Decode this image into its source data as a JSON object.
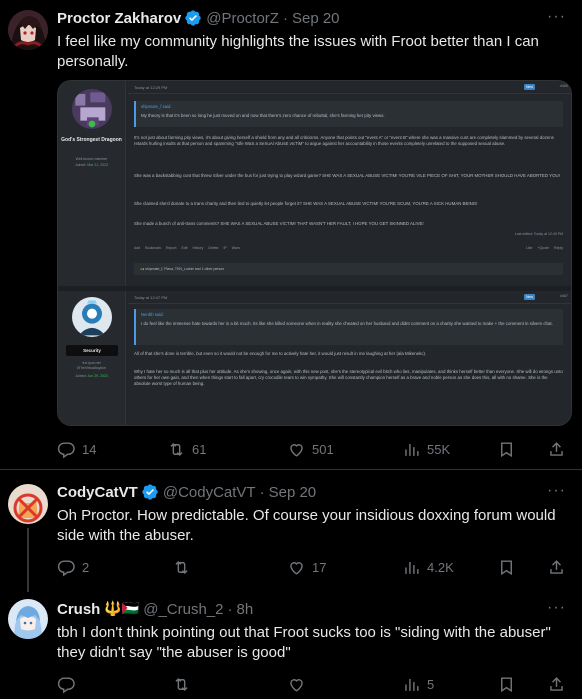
{
  "tweets": [
    {
      "name": "Proctor Zakharov",
      "handle": "@ProctorZ",
      "time": "Sep 20",
      "text": "I feel like my community highlights the issues with Froot better than I can personally.",
      "stats": {
        "replies": "14",
        "reposts": "61",
        "likes": "501",
        "views": "55K"
      },
      "avatar_icon": "anime-avatar-icon"
    },
    {
      "name": "CodyCatVT",
      "handle": "@CodyCatVT",
      "time": "Sep 20",
      "text": "Oh Proctor. How predictable. Of course your insidious doxxing forum would side with the abuser.",
      "stats": {
        "replies": "2",
        "reposts": "",
        "likes": "17",
        "views": "4.2K"
      },
      "avatar_icon": "cat-no-symbol-icon"
    },
    {
      "name": "Crush",
      "handle": "@_Crush_2",
      "time": "8h",
      "name_emojis": "🔱🇵🇸",
      "text": "tbh I don't think pointing out that Froot sucks too is \"siding with the abuser\" they didn't say \"the abuser is good\"",
      "stats": {
        "replies": "",
        "reposts": "",
        "likes": "",
        "views": "5"
      },
      "avatar_icon": "anime-avatar-blue-icon"
    }
  ],
  "forum": {
    "post1": {
      "timestamp": "Today at 12:29 PM",
      "badge": "New",
      "number": "#465",
      "user_title": "God's Strongest Dragoon",
      "user_role": "Well-known member",
      "joined_label": "Joined:",
      "joined": "Mar 21, 2023",
      "quote_author": "shipmate_f said:",
      "quote_text": "My theory is that it's been so long he just moved on and now that there's zero chance of rebuttal, she's farming her pity views.",
      "paragraphs": [
        "It's not just about farming pity views, it's about giving herself a shield from any and all criticisms. Anyone that points out \"event A\" or \"event B\" where she was a massive cunt are completely slammed by several dozens retards hurling insults at that person and spamming \"stfe WaS a SeXuAl AbUsE vIcTiM\" to argue against her accountability in those events completely unrelated to the supposed sexual abuse.",
        "She was a backstabbing cunt that threw Silver under the bus for just trying to play wizard game? SHE WAS A SEXUAL ABUSE VICTIM! YOU'RE VILE PIECE OF SHIT, YOUR MOTHER SHOULD HAVE ABORTED YOU!",
        "She claimed she'd donate to a trans charity and then lied to quietly let people forget it? SHE WAS A SEXUAL ABUSE VICTIM! YOU'RE SCUM, YOU'RE A SICK HUMAN BEING!",
        "She made a bunch of anti-trans comments? SHE WAS A SEXUAL ABUSE VICTIM! THAT WASN'T HER FAULT, I HOPE YOU GET SKINNED ALIVE!"
      ],
      "edited": "Last edited: Today at 12:49 PM",
      "links": [
        "Add Bookmark",
        "Report",
        "Edit",
        "History",
        "Delete",
        "IP",
        "Warn"
      ],
      "actions": [
        "Like",
        "+Quote",
        "Reply"
      ],
      "reactions": "shipmate_f, Plava, TKN_Lurker and 1 other person"
    },
    "post2": {
      "timestamp": "Today at 12:47 PM",
      "badge": "New",
      "number": "#467",
      "user_badge": "Security",
      "user_role": "trci.ipun.net",
      "user_tag": "#TheVirtualAsylum",
      "joined_label": "Joined:",
      "joined": "Jun 29, 2023",
      "quote_author": "Nerdth said:",
      "quote_text": "I do feel like the immense hate towards her is a bit much. Its like she killed someone when in reality she cheated on her husband and didnt comment on a charity she wanted to make + the comment in silvers chat.",
      "paragraphs": [
        "All of that she's done is terrible, but even so it would not be enough for me to actively hate her, it would just result in me laughing at her (ala Mikenekc).",
        "Why I hate her so much is all that plus her attitude. As she's showing, once again, with this new post, she's the stereotypical evil bitch who lies, manipulates, and thinks herself better than everyone. She will do wrongs unto others for her own gain, and then when things start to fall apart, cry crocodile tears to win sympathy. She will constantly champion herself as a brave and noble person as she does this, all with no shame. She is the absolute worst type of human being."
      ]
    }
  },
  "colors": {
    "background": "#000000",
    "text": "#e7e9ea",
    "muted": "#71767b",
    "verified": "#1d9bf0",
    "divider": "#2f3336"
  }
}
